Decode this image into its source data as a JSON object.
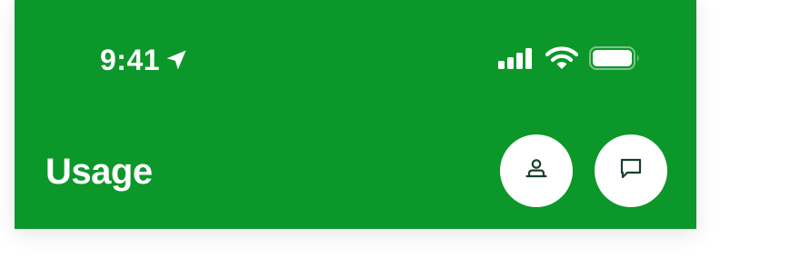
{
  "status_bar": {
    "time": "9:41",
    "icons": [
      "location-arrow-icon",
      "cellular-signal-icon",
      "wifi-icon",
      "battery-icon"
    ]
  },
  "header": {
    "title": "Usage",
    "background_color": "#0C972A",
    "actions": [
      {
        "icon": "profile-icon"
      },
      {
        "icon": "chat-icon"
      }
    ]
  }
}
